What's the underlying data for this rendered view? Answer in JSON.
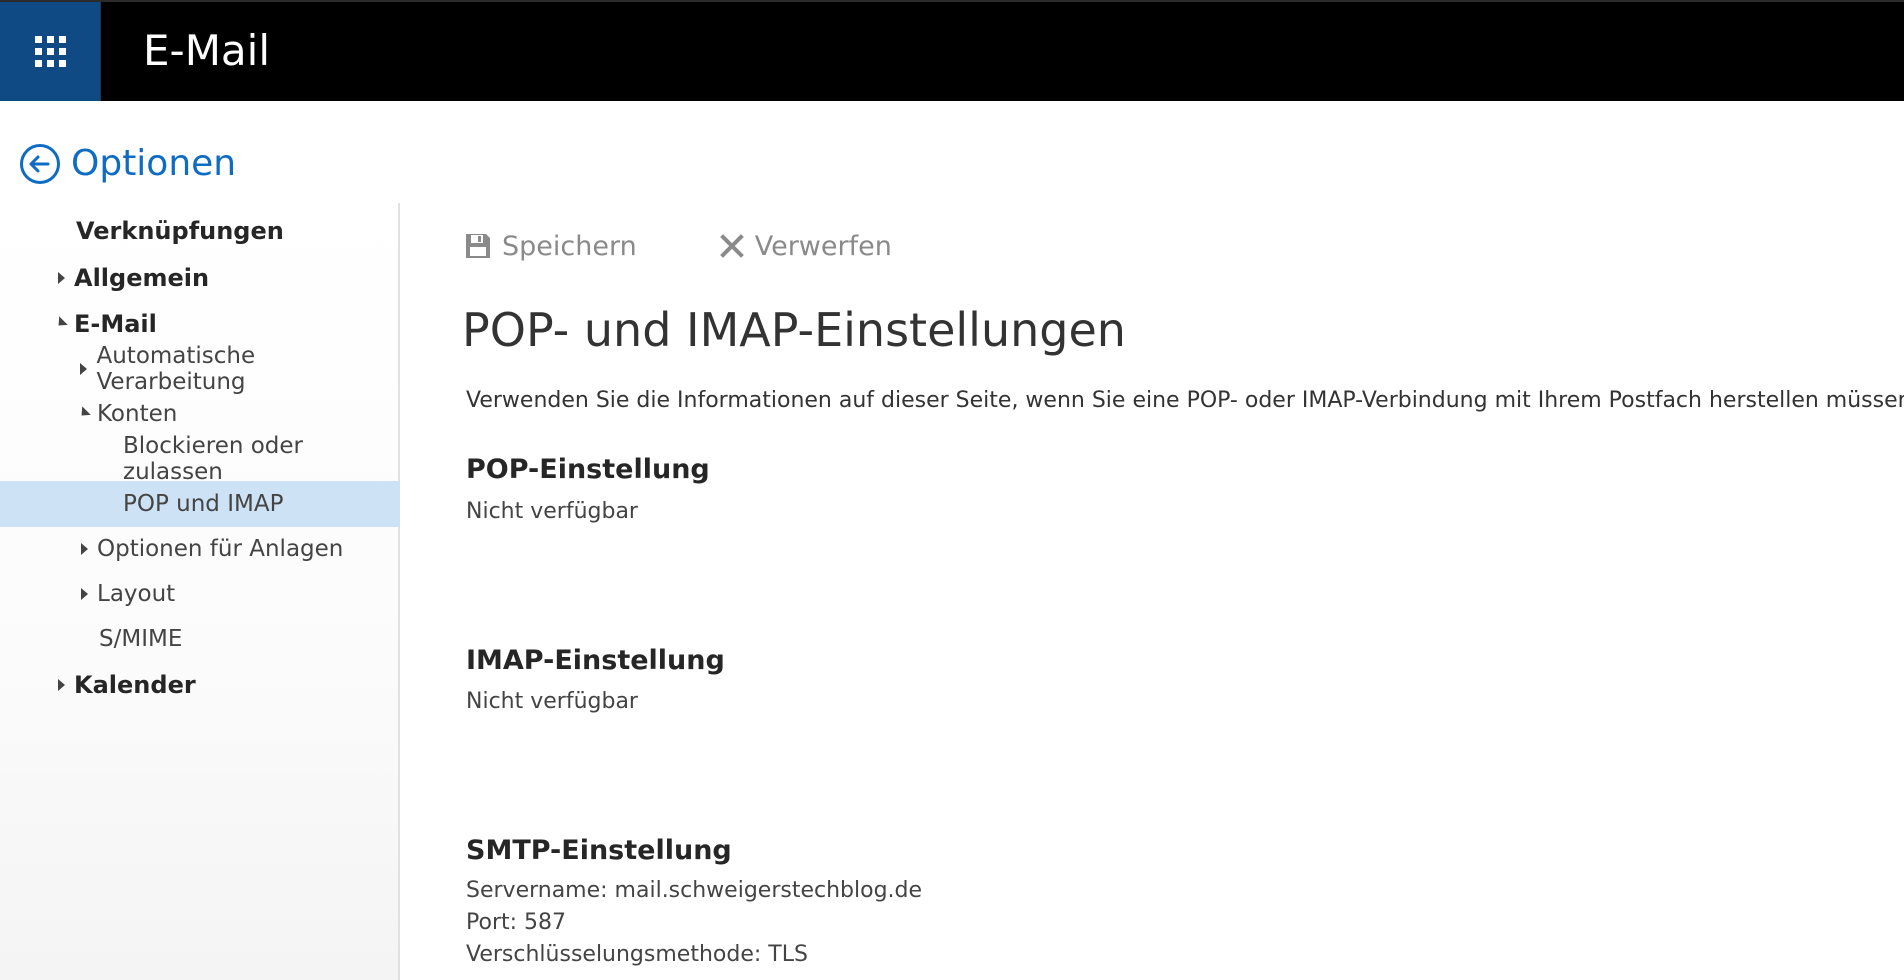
{
  "header": {
    "app_title": "E-Mail",
    "launcher_icon": "waffle-icon"
  },
  "options": {
    "back_label": "Optionen",
    "back_icon": "back-arrow-circle-icon",
    "accent_color": "#0f6cc4"
  },
  "nav": {
    "items": [
      {
        "label": "Verknüpfungen",
        "level": 0,
        "expander": "none",
        "bold": true,
        "selected": false
      },
      {
        "label": "Allgemein",
        "level": 0,
        "expander": "collapsed",
        "bold": true,
        "selected": false
      },
      {
        "label": "E-Mail",
        "level": 0,
        "expander": "expanded",
        "bold": true,
        "selected": false
      },
      {
        "label": "Automatische Verarbeitung",
        "level": 1,
        "expander": "collapsed",
        "bold": false,
        "selected": false
      },
      {
        "label": "Konten",
        "level": 1,
        "expander": "expanded",
        "bold": false,
        "selected": false
      },
      {
        "label": "Blockieren oder zulassen",
        "level": 2,
        "expander": "none",
        "bold": false,
        "selected": false
      },
      {
        "label": "POP und IMAP",
        "level": 2,
        "expander": "none",
        "bold": false,
        "selected": true
      },
      {
        "label": "Optionen für Anlagen",
        "level": 1,
        "expander": "collapsed",
        "bold": false,
        "selected": false
      },
      {
        "label": "Layout",
        "level": 1,
        "expander": "collapsed",
        "bold": false,
        "selected": false
      },
      {
        "label": "S/MIME",
        "level": 1,
        "expander": "none",
        "bold": false,
        "selected": false
      },
      {
        "label": "Kalender",
        "level": 0,
        "expander": "collapsed",
        "bold": true,
        "selected": false
      }
    ],
    "selected_color": "#cde3f5"
  },
  "toolbar": {
    "save_label": "Speichern",
    "save_icon": "floppy-disk-icon",
    "discard_label": "Verwerfen",
    "discard_icon": "close-x-icon"
  },
  "content": {
    "title": "POP- und IMAP-Einstellungen",
    "intro": "Verwenden Sie die Informationen auf dieser Seite, wenn Sie eine POP- oder IMAP-Verbindung mit Ihrem Postfach herstellen müssen.",
    "pop": {
      "heading": "POP-Einstellung",
      "value": "Nicht verfügbar"
    },
    "imap": {
      "heading": "IMAP-Einstellung",
      "value": "Nicht verfügbar"
    },
    "smtp": {
      "heading": "SMTP-Einstellung",
      "server": "Servername: mail.schweigerstechblog.de",
      "port": "Port: 587",
      "encryption": "Verschlüsselungsmethode: TLS"
    }
  }
}
